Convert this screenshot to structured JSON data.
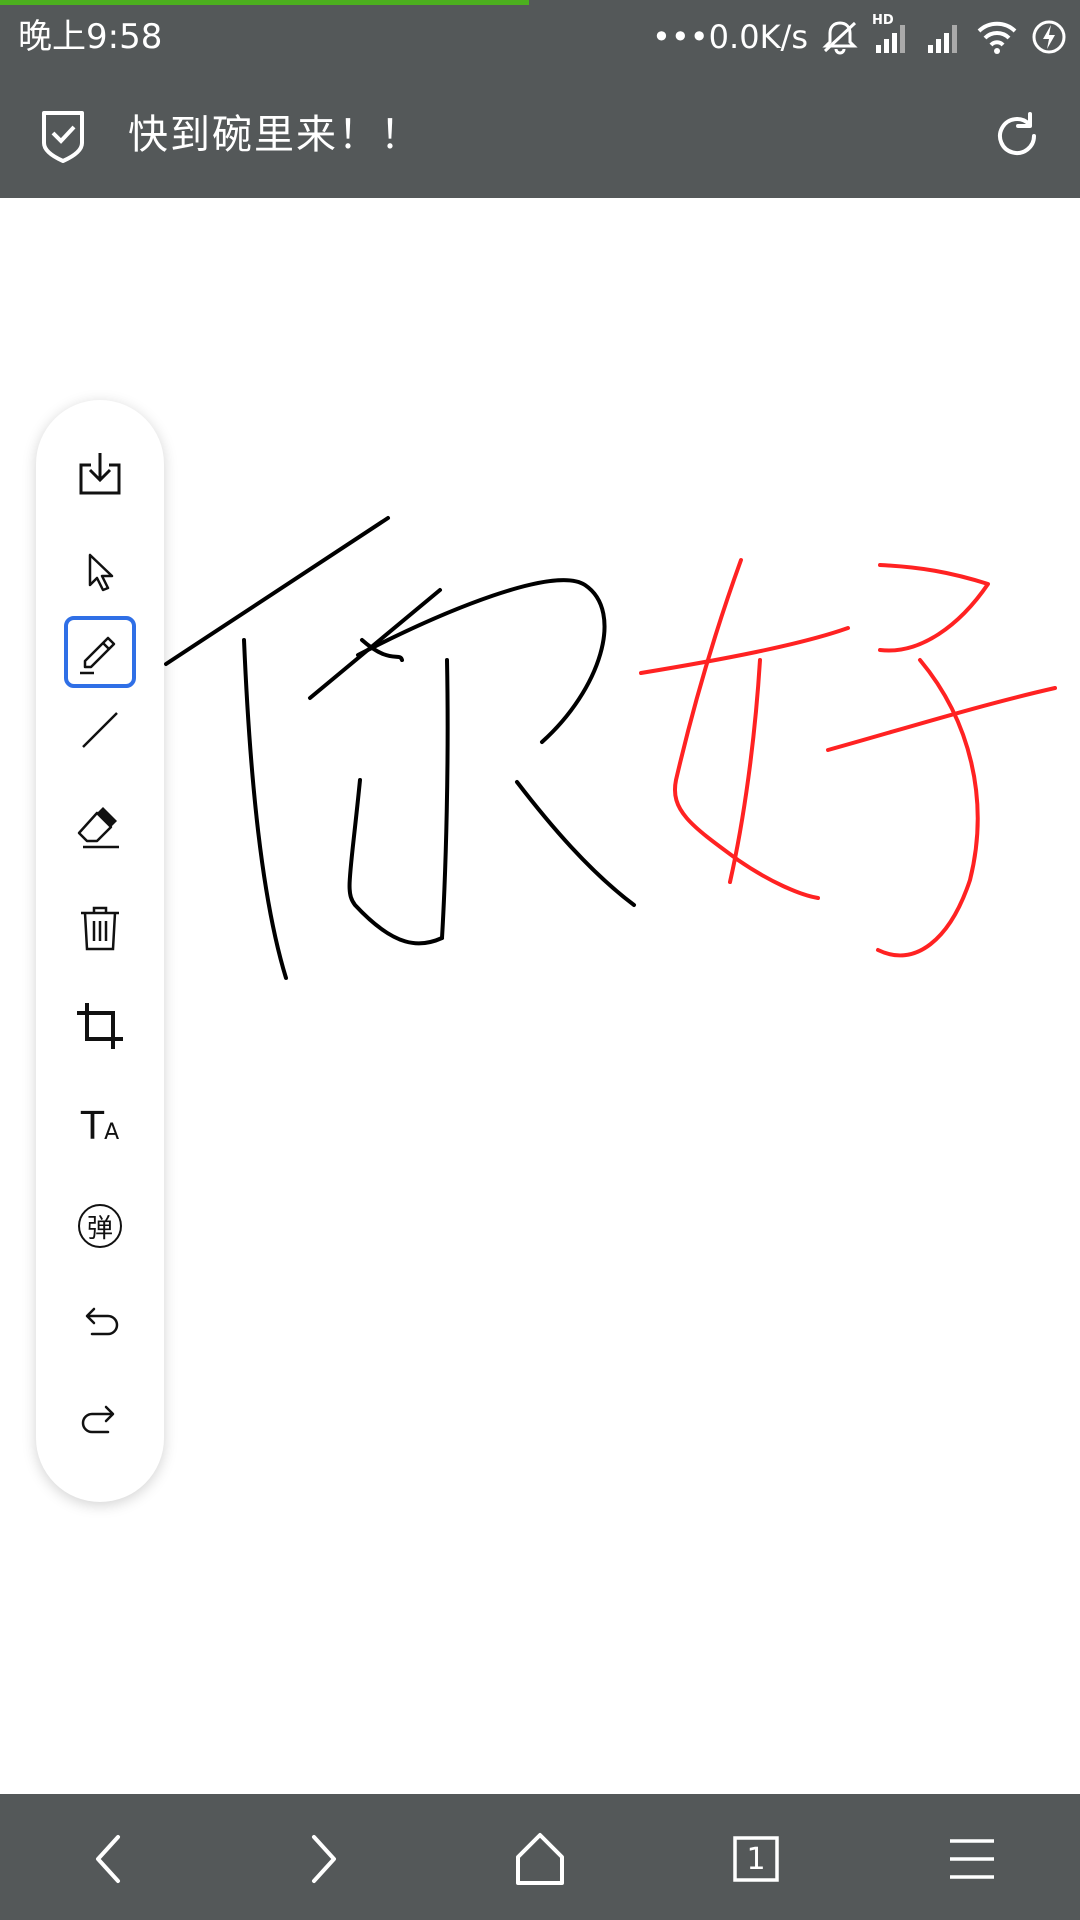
{
  "status_bar": {
    "time": "晚上9:58",
    "net_speed": "•••0.0K/s",
    "signal_badge": "HD",
    "icons": [
      "mute-icon",
      "signal-hd-icon",
      "signal-icon",
      "wifi-icon",
      "charging-icon"
    ],
    "load_progress": 0.49,
    "progress_color": "#4caf1f"
  },
  "header": {
    "title": "快到碗里来！！",
    "icons": [
      "shield-check-icon",
      "refresh-icon"
    ]
  },
  "toolbar": {
    "tools": [
      {
        "name": "save-tool",
        "icon": "download-icon"
      },
      {
        "name": "select-tool",
        "icon": "cursor-icon"
      },
      {
        "name": "pen-tool",
        "icon": "pencil-icon",
        "active": true
      },
      {
        "name": "line-tool",
        "icon": "line-icon"
      },
      {
        "name": "eraser-tool",
        "icon": "eraser-icon"
      },
      {
        "name": "clear-tool",
        "icon": "trash-icon"
      },
      {
        "name": "crop-tool",
        "icon": "crop-icon"
      },
      {
        "name": "text-tool",
        "icon": "text-size-icon",
        "label_big": "T",
        "label_small": "A"
      },
      {
        "name": "danmaku-tool",
        "icon": "danmaku-icon",
        "label": "弹"
      },
      {
        "name": "undo-tool",
        "icon": "undo-icon"
      },
      {
        "name": "redo-tool",
        "icon": "redo-icon"
      }
    ],
    "active_color": "#2f6fe6"
  },
  "drawing": {
    "stroke_colors": {
      "ni": "#000000",
      "hao": "#ff2222"
    }
  },
  "bottom_nav": {
    "items": [
      "back-icon",
      "forward-icon",
      "home-icon",
      "tabs-icon",
      "menu-icon"
    ],
    "tab_count": "1"
  },
  "colors": {
    "bar_bg": "#545859",
    "accent": "#2f6fe6"
  }
}
